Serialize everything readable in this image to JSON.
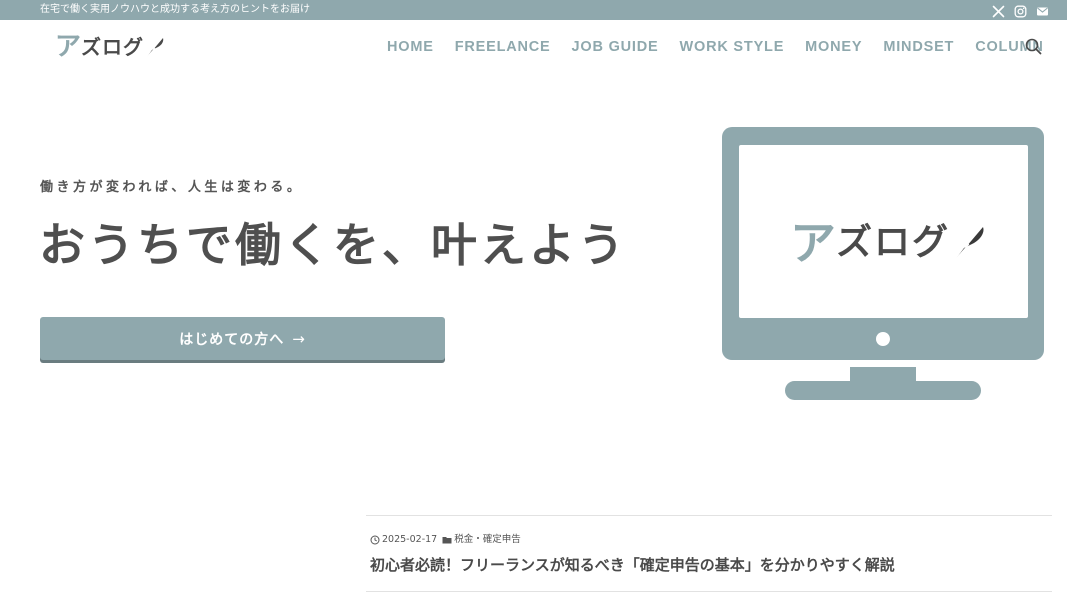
{
  "topbar": {
    "tagline": "在宅で働く実用ノウハウと成功する考え方のヒントをお届け",
    "social": [
      "x-icon",
      "instagram-icon",
      "mail-icon"
    ]
  },
  "header": {
    "logo": {
      "first": "ア",
      "rest": "ズログ"
    },
    "nav": [
      "HOME",
      "FREELANCE",
      "JOB GUIDE",
      "WORK STYLE",
      "MONEY",
      "MINDSET",
      "COLUMN"
    ],
    "search_icon": "search-icon"
  },
  "hero": {
    "catch": "働き方が変われば、人生は変わる。",
    "headline": "おうちで働くを、叶えよう",
    "cta_label": "はじめての方へ",
    "cta_arrow": "→",
    "monitor_logo": {
      "first": "ア",
      "rest": "ズログ"
    }
  },
  "post": {
    "date": "2025-02-17",
    "category": "税金・確定申告",
    "title": "初心者必読！フリーランスが知るべき「確定申告の基本」を分かりやすく解説"
  },
  "colors": {
    "accent": "#8fa8ad",
    "text": "#4a4a4a",
    "background": "#ffffff"
  }
}
